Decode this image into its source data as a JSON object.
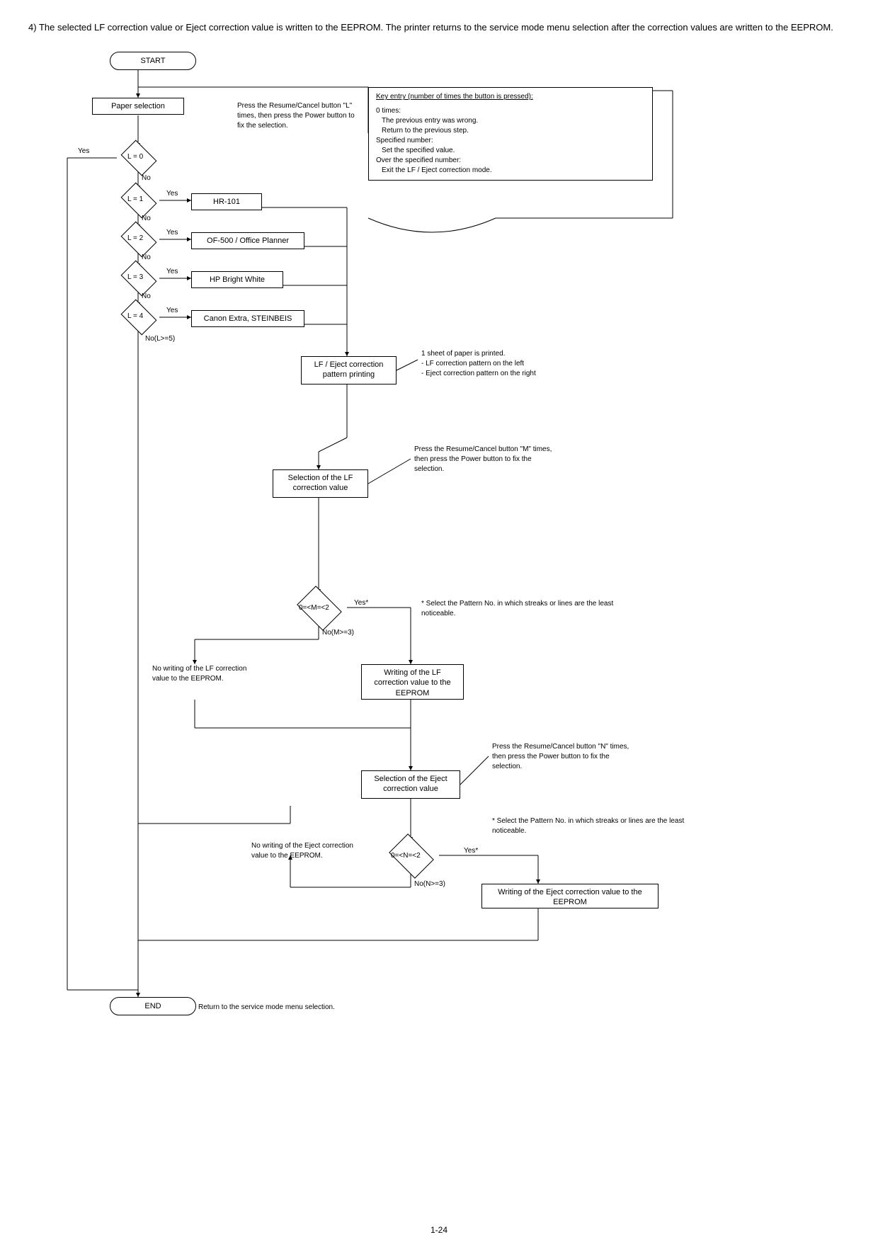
{
  "instruction": {
    "number": "4)",
    "text": "The selected LF correction value or Eject correction value is written to the EEPROM. The printer returns to the service mode menu selection after the correction values are written to the EEPROM."
  },
  "flowchart": {
    "start": "START",
    "paper_selection": "Paper selection",
    "press_l_note": "Press the Resume/Cancel button \"L\" times, then press the Power button to fix the selection.",
    "key_entry_title": "Key entry (number of times the button is pressed):",
    "key_0_times": "0 times:",
    "key_0_line1": "The previous entry was wrong.",
    "key_0_line2": "Return to the previous step.",
    "key_specified": "Specified number:",
    "key_specified_line": "Set the specified value.",
    "key_over": "Over the specified number:",
    "key_over_line": "Exit the LF / Eject correction mode.",
    "l0": "L = 0",
    "l1": "L = 1",
    "l2": "L = 2",
    "l3": "L = 3",
    "l4": "L = 4",
    "hr101": "HR-101",
    "of500": "OF-500 / Office Planner",
    "hp_bright": "HP Bright White",
    "canon_extra": "Canon Extra, STEINBEIS",
    "no_l5": "No(L>=5)",
    "lf_eject_print": "LF / Eject correction pattern printing",
    "one_sheet": "1 sheet of paper is printed.",
    "lf_pattern_left": "- LF correction pattern on the left",
    "eject_pattern_right": "- Eject correction pattern on the right",
    "select_lf": "Selection of the LF correction value",
    "press_m_note": "Press the Resume/Cancel button \"M\" times, then press the Power button to fix the selection.",
    "m_cond": "0=<M=<2",
    "no_m3": "No(M>=3)",
    "select_pattern_note": "* Select the Pattern No. in which streaks or lines are the least noticeable.",
    "no_write_lf": "No writing of the LF correction value to the EEPROM.",
    "write_lf": "Writing of the LF correction value to the EEPROM",
    "select_eject": "Selection of the Eject correction value",
    "press_n_note": "Press the Resume/Cancel button \"N\" times, then press the Power button to fix the selection.",
    "n_cond": "0=<N=<2",
    "no_n3": "No(N>=3)",
    "no_write_eject": "No writing of the Eject correction value to the EEPROM.",
    "write_eject": "Writing of the Eject correction value to the EEPROM",
    "select_pattern_note2": "* Select the Pattern No. in which streaks or lines are the least noticeable.",
    "end": "END",
    "return_note": "Return to the service mode menu selection.",
    "yes": "Yes",
    "no": "No",
    "yes_star": "Yes*"
  },
  "page_number": "1-24"
}
